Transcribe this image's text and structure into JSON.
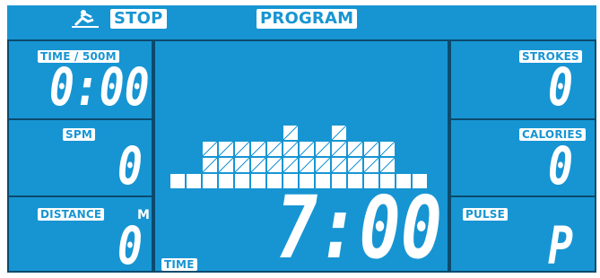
{
  "header": {
    "rower_icon": "rower-icon",
    "stop_label": "STOP",
    "program_label": "PROGRAM"
  },
  "left": {
    "time_label": "TIME / 500M",
    "time_value": "0:00",
    "spm_label": "SPM",
    "spm_value": "0",
    "distance_label": "DISTANCE",
    "distance_unit": "M",
    "distance_value": "0"
  },
  "center": {
    "time_label": "TIME",
    "time_value": "7:00",
    "profile_columns": [
      1,
      1,
      3,
      3,
      3,
      3,
      3,
      4,
      3,
      3,
      4,
      3,
      3,
      3,
      1,
      1
    ],
    "profile_hatched_from_row": 2
  },
  "right": {
    "strokes_label": "STROKES",
    "strokes_value": "0",
    "calories_label": "CALORIES",
    "calories_value": "0",
    "pulse_label": "PULSE",
    "pulse_value": "P"
  },
  "colors": {
    "lcd_background": "#1795d3",
    "segment": "#ffffff",
    "frame": "#0b4a6c"
  }
}
